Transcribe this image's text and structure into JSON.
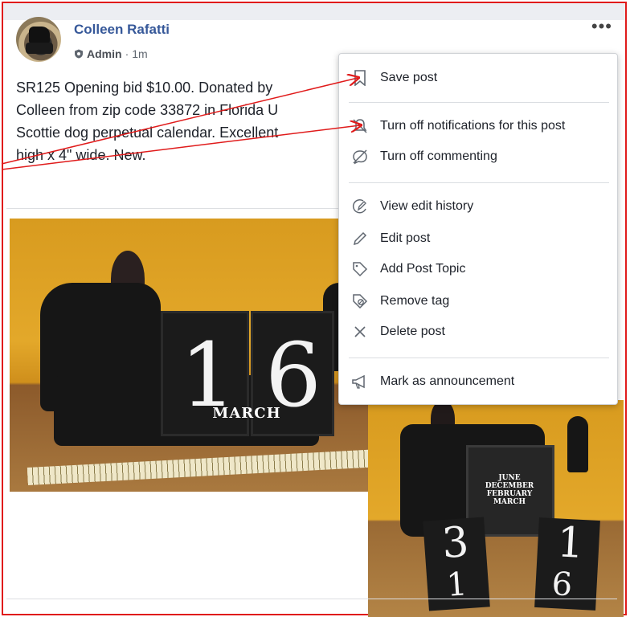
{
  "post": {
    "author": "Colleen Rafatti",
    "role": "Admin",
    "time": "1m",
    "text_lines": [
      "SR125 Opening bid $10.00. Donated by",
      "Colleen from zip code 33872 in Florida U",
      "Scottie dog perpetual calendar. Excellent",
      "high x 4\" wide. New."
    ]
  },
  "photo1": {
    "digit_left": "1",
    "digit_right": "6",
    "month": "MARCH"
  },
  "photo2": {
    "months": [
      "JUNE",
      "DECEMBER",
      "FEBRUARY",
      "MARCH"
    ],
    "cube_a_top": "3",
    "cube_a_bottom": "1",
    "cube_b_top": "1",
    "cube_b_bottom": "6"
  },
  "menu": {
    "items": [
      {
        "label": "Save post",
        "icon": "bookmark-icon"
      },
      {
        "label": "Turn off notifications for this post",
        "icon": "bell-off-icon"
      },
      {
        "label": "Turn off commenting",
        "icon": "comment-off-icon"
      },
      {
        "label": "View edit history",
        "icon": "edit-history-icon"
      },
      {
        "label": "Edit post",
        "icon": "pencil-icon"
      },
      {
        "label": "Add Post Topic",
        "icon": "tag-icon"
      },
      {
        "label": "Remove tag",
        "icon": "remove-tag-icon"
      },
      {
        "label": "Delete post",
        "icon": "close-icon"
      },
      {
        "label": "Mark as announcement",
        "icon": "megaphone-icon"
      }
    ]
  },
  "colors": {
    "author_link": "#365899",
    "annotation_border": "#e01b1b",
    "menu_text": "#1d2129"
  }
}
